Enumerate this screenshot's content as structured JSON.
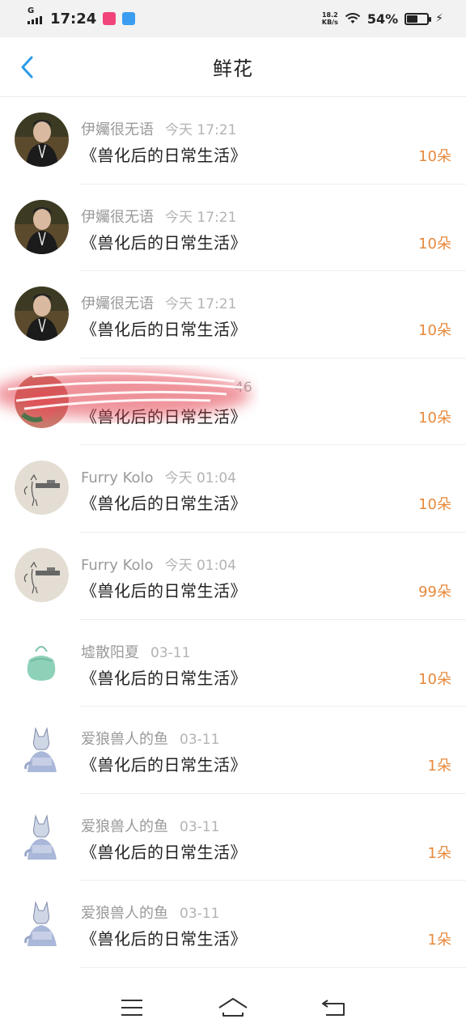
{
  "status_bar": {
    "network": "G",
    "time": "17:24",
    "net_speed_value": "18.2",
    "net_speed_unit": "KB/s",
    "battery_percent": "54%",
    "battery_level": 0.54
  },
  "header": {
    "title": "鲜花"
  },
  "list": [
    {
      "user": "伊孎很无语",
      "time": "今天 17:21",
      "book": "《兽化后的日常生活》",
      "count": "10朵",
      "avatar": "person-avatar"
    },
    {
      "user": "伊孎很无语",
      "time": "今天 17:21",
      "book": "《兽化后的日常生活》",
      "count": "10朵",
      "avatar": "person-avatar"
    },
    {
      "user": "伊孎很无语",
      "time": "今天 17:21",
      "book": "《兽化后的日常生活》",
      "count": "10朵",
      "avatar": "person-avatar"
    },
    {
      "user": "",
      "time": "46",
      "book": "《兽化后的日常生活》",
      "count": "10朵",
      "avatar": "redacted-avatar"
    },
    {
      "user": "Furry Kolo",
      "time": "今天 01:04",
      "book": "《兽化后的日常生活》",
      "count": "10朵",
      "avatar": "sketch-avatar"
    },
    {
      "user": "Furry Kolo",
      "time": "今天 01:04",
      "book": "《兽化后的日常生活》",
      "count": "99朵",
      "avatar": "sketch-avatar"
    },
    {
      "user": "墟散阳夏",
      "time": "03-11",
      "book": "《兽化后的日常生活》",
      "count": "10朵",
      "avatar": "bag-avatar"
    },
    {
      "user": "爱狼兽人的鱼",
      "time": "03-11",
      "book": "《兽化后的日常生活》",
      "count": "1朵",
      "avatar": "wolf-avatar"
    },
    {
      "user": "爱狼兽人的鱼",
      "time": "03-11",
      "book": "《兽化后的日常生活》",
      "count": "1朵",
      "avatar": "wolf-avatar"
    },
    {
      "user": "爱狼兽人的鱼",
      "time": "03-11",
      "book": "《兽化后的日常生活》",
      "count": "1朵",
      "avatar": "wolf-avatar"
    }
  ],
  "colors": {
    "accent": "#e7893c",
    "back_arrow": "#2b9be8",
    "scribble": "#e23a4a"
  },
  "icons": {
    "back": "chevron-left-icon",
    "menu": "menu-icon",
    "home": "home-icon",
    "return": "return-icon"
  }
}
